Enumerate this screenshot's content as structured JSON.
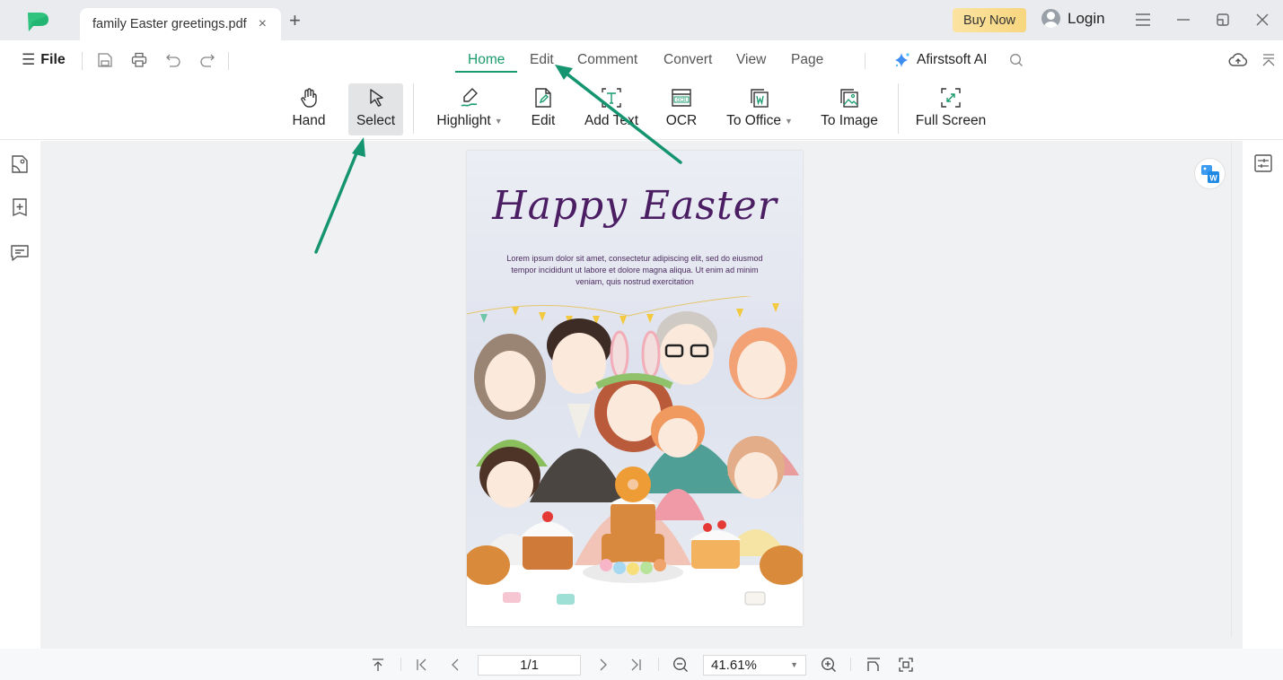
{
  "titlebar": {
    "tab_title": "family Easter greetings.pdf",
    "tab_close": "×",
    "new_tab": "+",
    "buy_now": "Buy Now",
    "login": "Login"
  },
  "menubar": {
    "file_label": "File",
    "tabs": [
      {
        "label": "Home",
        "active": true
      },
      {
        "label": "Edit",
        "active": false
      },
      {
        "label": "Comment",
        "active": false
      },
      {
        "label": "Convert",
        "active": false
      },
      {
        "label": "View",
        "active": false
      },
      {
        "label": "Page",
        "active": false
      }
    ],
    "ai_label": "Afirstsoft AI"
  },
  "ribbon": {
    "items": [
      {
        "label": "Hand",
        "icon": "hand-icon"
      },
      {
        "label": "Select",
        "icon": "cursor-icon",
        "selected": true
      },
      {
        "label": "Highlight",
        "icon": "highlighter-icon",
        "dropdown": true
      },
      {
        "label": "Edit",
        "icon": "edit-doc-icon"
      },
      {
        "label": "Add Text",
        "icon": "add-text-icon"
      },
      {
        "label": "OCR",
        "icon": "ocr-icon"
      },
      {
        "label": "To Office",
        "icon": "to-office-icon",
        "dropdown": true
      },
      {
        "label": "To Image",
        "icon": "to-image-icon"
      },
      {
        "label": "Full Screen",
        "icon": "fullscreen-icon"
      }
    ]
  },
  "document": {
    "title": "Happy Easter",
    "body": "Lorem ipsum dolor sit amet, consectetur adipiscing elit, sed do eiusmod tempor incididunt ut labore et dolore magna aliqua. Ut enim ad minim veniam, quis nostrud exercitation"
  },
  "statusbar": {
    "page_value": "1/1",
    "zoom_value": "41.61%"
  },
  "colors": {
    "accent": "#1a9b6c",
    "arrow": "#14946f",
    "buy_now_bg": "#f8dc8c",
    "title_purple": "#4b1d63"
  }
}
